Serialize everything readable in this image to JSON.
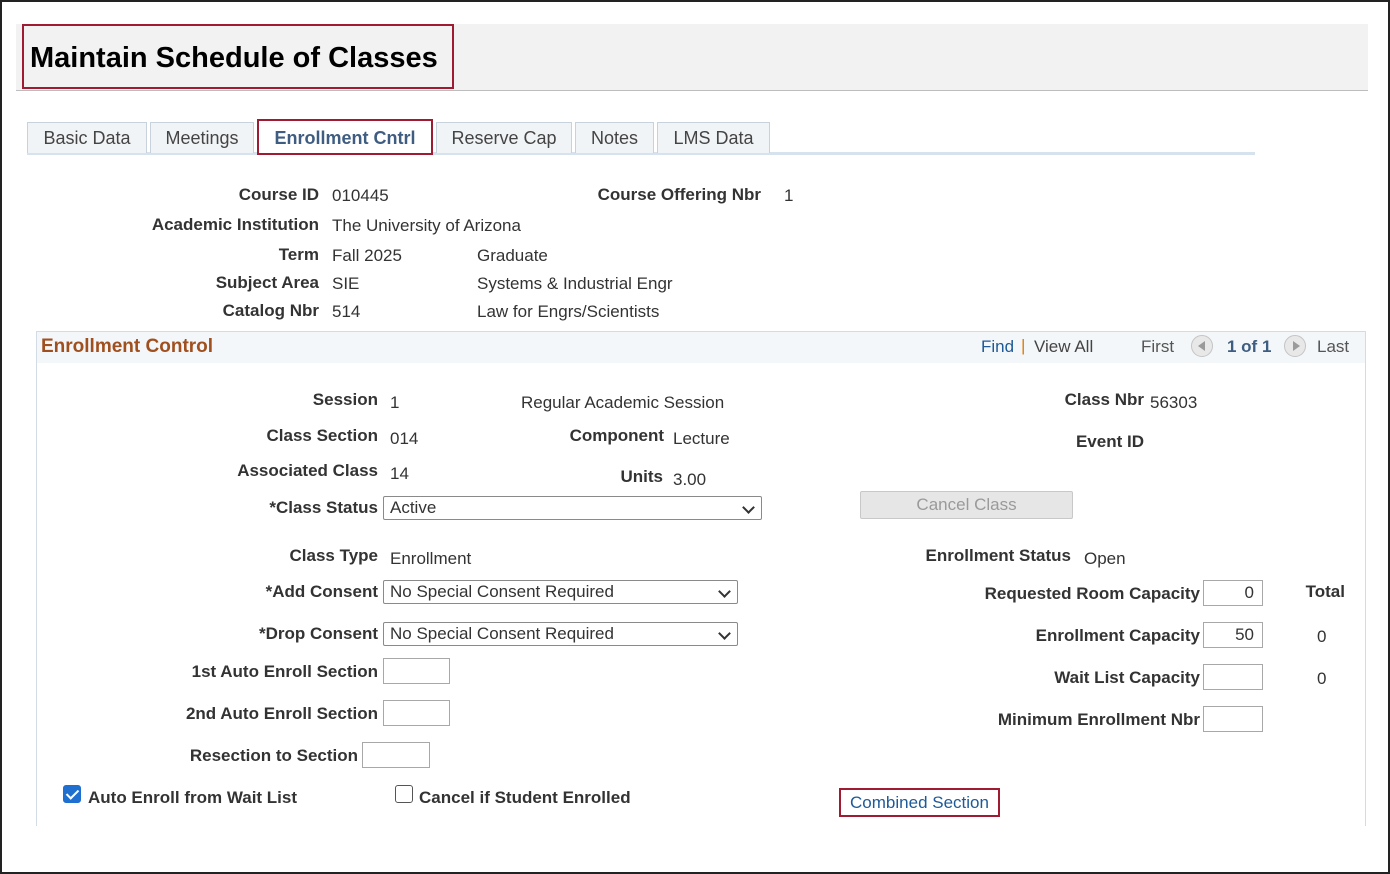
{
  "page": {
    "title": "Maintain Schedule of Classes"
  },
  "tabs": [
    {
      "label": "Basic Data"
    },
    {
      "label": "Meetings"
    },
    {
      "label": "Enrollment Cntrl"
    },
    {
      "label": "Reserve Cap"
    },
    {
      "label": "Notes"
    },
    {
      "label": "LMS Data"
    }
  ],
  "course": {
    "course_id_label": "Course ID",
    "course_id": "010445",
    "offering_label": "Course Offering Nbr",
    "offering": "1",
    "institution_label": "Academic Institution",
    "institution": "The University of Arizona",
    "term_label": "Term",
    "term": "Fall 2025",
    "career": "Graduate",
    "subject_label": "Subject Area",
    "subject": "SIE",
    "subject_desc": "Systems & Industrial Engr",
    "catalog_label": "Catalog Nbr",
    "catalog": "514",
    "catalog_desc": "Law for Engrs/Scientists"
  },
  "panel": {
    "title": "Enrollment Control",
    "find": "Find",
    "separator": "|",
    "view_all": "View All",
    "first": "First",
    "page_info": "1 of 1",
    "last": "Last"
  },
  "enrollment": {
    "session_label": "Session",
    "session": "1",
    "session_desc": "Regular Academic Session",
    "class_nbr_label": "Class Nbr",
    "class_nbr": "56303",
    "class_section_label": "Class Section",
    "class_section": "014",
    "component_label": "Component",
    "component": "Lecture",
    "event_id_label": "Event ID",
    "associated_label": "Associated Class",
    "associated": "14",
    "units_label": "Units",
    "units": "3.00",
    "class_status_label": "*Class Status",
    "class_status": "Active",
    "cancel_class": "Cancel Class",
    "class_type_label": "Class Type",
    "class_type": "Enrollment",
    "enroll_status_label": "Enrollment Status",
    "enroll_status": "Open",
    "add_consent_label": "*Add Consent",
    "add_consent": "No Special Consent Required",
    "drop_consent_label": "*Drop Consent",
    "drop_consent": "No Special Consent Required",
    "auto1_label": "1st Auto Enroll Section",
    "auto2_label": "2nd Auto Enroll Section",
    "resection_label": "Resection to Section",
    "req_room_label": "Requested Room Capacity",
    "req_room": "0",
    "total_label": "Total",
    "enroll_cap_label": "Enrollment Capacity",
    "enroll_cap": "50",
    "enroll_total": "0",
    "waitlist_label": "Wait List Capacity",
    "waitlist": "",
    "waitlist_total": "0",
    "min_enroll_label": "Minimum Enrollment Nbr",
    "min_enroll": "",
    "auto_enroll_wait_label": "Auto Enroll from Wait List",
    "auto_enroll_wait_checked": true,
    "cancel_if_enrolled_label": "Cancel if Student Enrolled",
    "cancel_if_enrolled_checked": false,
    "combined_section": "Combined Section"
  }
}
